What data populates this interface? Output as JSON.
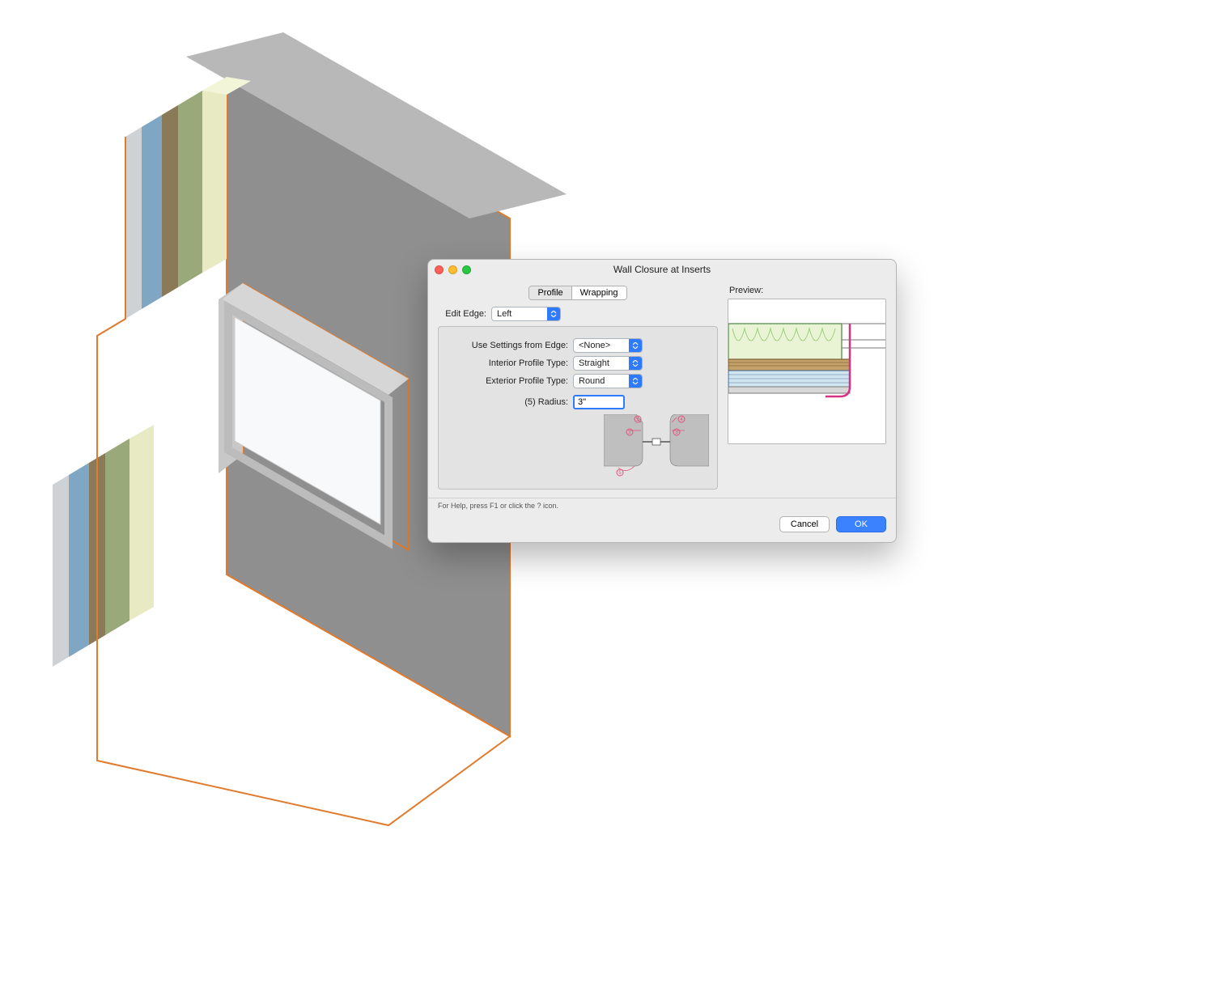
{
  "dialog": {
    "title": "Wall Closure at Inserts",
    "tabs": {
      "profile": "Profile",
      "wrapping": "Wrapping",
      "active": "Profile"
    },
    "edit_edge_label": "Edit Edge:",
    "edit_edge_value": "Left",
    "use_settings_label": "Use Settings from Edge:",
    "use_settings_value": "<None>",
    "interior_profile_label": "Interior Profile Type:",
    "interior_profile_value": "Straight",
    "exterior_profile_label": "Exterior Profile Type:",
    "exterior_profile_value": "Round",
    "radius_label": "(5) Radius:",
    "radius_value": "3\"",
    "preview_label": "Preview:",
    "help_text": "For Help, press F1 or click the ? icon.",
    "cancel_label": "Cancel",
    "ok_label": "OK"
  },
  "diagram": {
    "markers": [
      "1",
      "2",
      "3",
      "4",
      "5"
    ]
  }
}
